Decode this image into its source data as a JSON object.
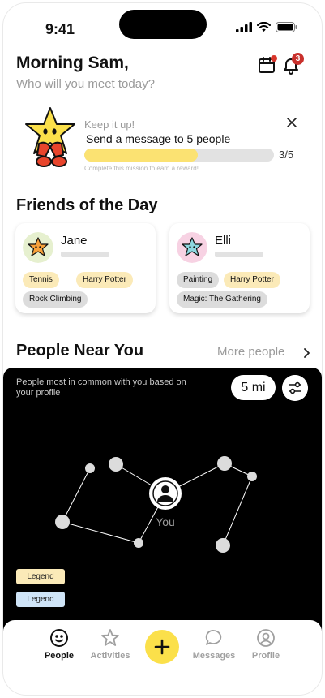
{
  "status_bar": {
    "time": "9:41"
  },
  "header": {
    "greeting": "Morning Sam,",
    "subtitle": "Who will you meet today?",
    "notifications_count": "3"
  },
  "mission": {
    "kicker": "Keep it up!",
    "title": "Send a message to 5 people",
    "progress_label": "3/5",
    "progress_fraction": 0.6,
    "hint": "Complete this mission to earn a reward!"
  },
  "friends_of_the_day": {
    "title": "Friends of the Day",
    "cards": [
      {
        "name": "Jane",
        "avatar_color": "#e6f0cf",
        "tags": [
          "Tennis",
          "Harry Potter",
          "Rock Climbing"
        ]
      },
      {
        "name": "Elli",
        "avatar_color": "#f7d2e3",
        "tags": [
          "Painting",
          "Harry Potter",
          "Magic: The Gathering"
        ]
      }
    ]
  },
  "people_near_you": {
    "title": "People Near You",
    "more_link": "More people",
    "caption": "People most in common with you based on your profile",
    "distance": "5 mi",
    "you_label": "You",
    "legend": [
      "Legend",
      "Legend"
    ]
  },
  "nav": {
    "items": [
      {
        "label": "People",
        "icon": "smiley-icon",
        "active": true
      },
      {
        "label": "Activities",
        "icon": "star-icon",
        "active": false
      },
      {
        "label": "Messages",
        "icon": "chat-bubble-icon",
        "active": false
      },
      {
        "label": "Profile",
        "icon": "profile-icon",
        "active": false
      }
    ],
    "fab_icon": "plus-icon"
  },
  "colors": {
    "accent_yellow": "#fbe04a",
    "badge_red": "#c9302c",
    "map_bg": "#000000"
  }
}
